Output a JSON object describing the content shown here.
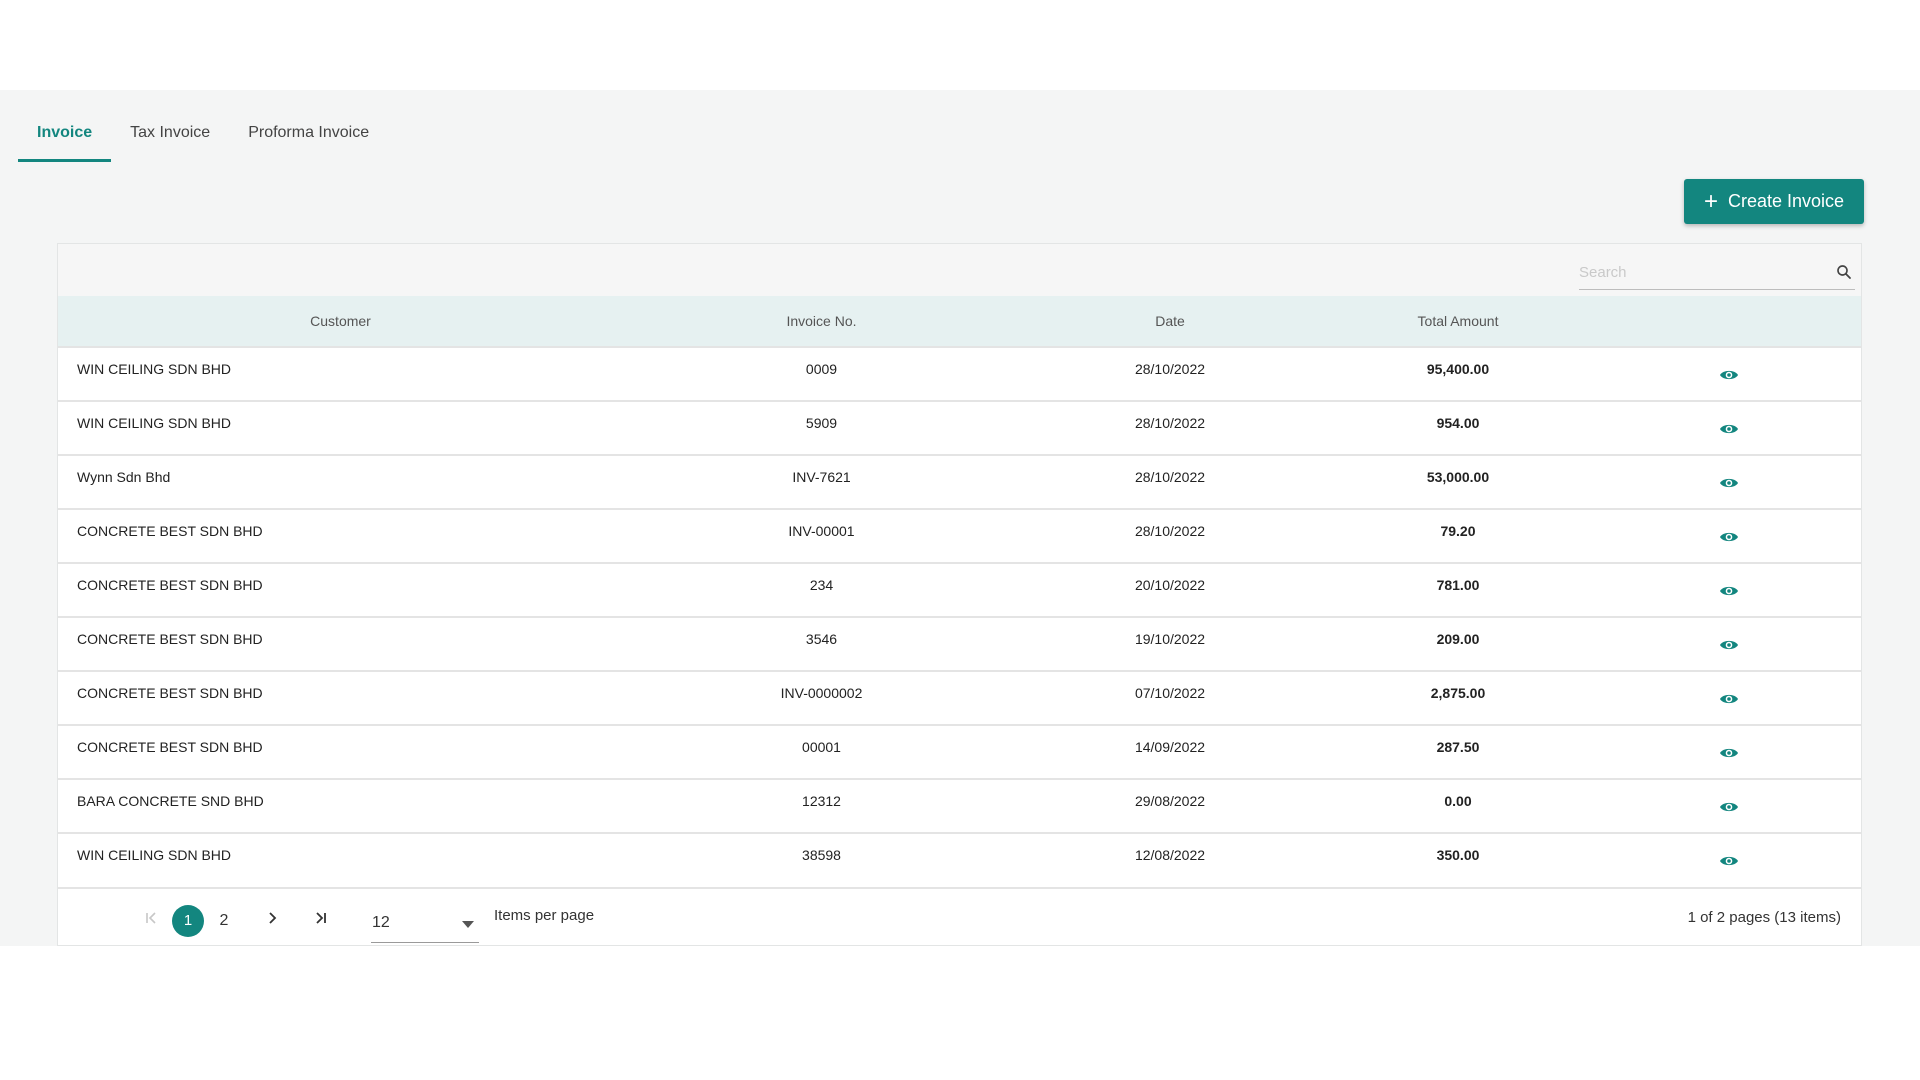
{
  "tabs": [
    {
      "label": "Invoice",
      "active": true
    },
    {
      "label": "Tax Invoice",
      "active": false
    },
    {
      "label": "Proforma Invoice",
      "active": false
    }
  ],
  "create_button": {
    "icon": "plus-icon",
    "label": "Create Invoice"
  },
  "search": {
    "placeholder": "Search",
    "value": "",
    "icon": "search-icon"
  },
  "table": {
    "columns": [
      "Customer",
      "Invoice No.",
      "Date",
      "Total Amount",
      ""
    ],
    "rows": [
      {
        "customer": "WIN CEILING SDN BHD",
        "invoice_no": "0009",
        "date": "28/10/2022",
        "amount": "95,400.00"
      },
      {
        "customer": "WIN CEILING SDN BHD",
        "invoice_no": "5909",
        "date": "28/10/2022",
        "amount": "954.00"
      },
      {
        "customer": "Wynn Sdn Bhd",
        "invoice_no": "INV-7621",
        "date": "28/10/2022",
        "amount": "53,000.00"
      },
      {
        "customer": "CONCRETE BEST SDN BHD",
        "invoice_no": "INV-00001",
        "date": "28/10/2022",
        "amount": "79.20"
      },
      {
        "customer": "CONCRETE BEST SDN BHD",
        "invoice_no": "234",
        "date": "20/10/2022",
        "amount": "781.00"
      },
      {
        "customer": "CONCRETE BEST SDN BHD",
        "invoice_no": "3546",
        "date": "19/10/2022",
        "amount": "209.00"
      },
      {
        "customer": "CONCRETE BEST SDN BHD",
        "invoice_no": "INV-0000002",
        "date": "07/10/2022",
        "amount": "2,875.00"
      },
      {
        "customer": "CONCRETE BEST SDN BHD",
        "invoice_no": "00001",
        "date": "14/09/2022",
        "amount": "287.50"
      },
      {
        "customer": "BARA CONCRETE SND BHD",
        "invoice_no": "12312",
        "date": "29/08/2022",
        "amount": "0.00"
      },
      {
        "customer": "WIN CEILING SDN BHD",
        "invoice_no": "38598",
        "date": "12/08/2022",
        "amount": "350.00"
      }
    ],
    "row_action_icon": "eye-icon"
  },
  "pager": {
    "pages": [
      "1",
      "2"
    ],
    "current": "1",
    "page_size": "12",
    "items_per_page_label": "Items per page",
    "info": "1 of 2 pages (13 items)"
  },
  "colors": {
    "accent": "#13867f",
    "header_bg": "#e6f1f1",
    "panel_bg": "#f4f5f5"
  }
}
